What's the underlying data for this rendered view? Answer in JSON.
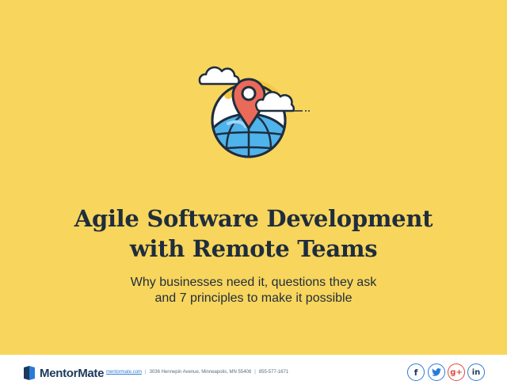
{
  "document": {
    "title_line1": "Agile Software Development",
    "title_line2": "with Remote Teams",
    "subtitle_line1": "Why businesses need it, questions they ask",
    "subtitle_line2": "and 7 principles to make it possible"
  },
  "footer": {
    "brand": "MentorMate",
    "website": "mentormate.com",
    "address": "3036 Hennepin Avenue, Minneapolis, MN 55408",
    "phone": "855-577-1671",
    "separator": "|",
    "social": [
      {
        "name": "facebook-icon",
        "glyph": "f"
      },
      {
        "name": "twitter-icon",
        "glyph": "t"
      },
      {
        "name": "google-plus-icon",
        "glyph": "g+"
      },
      {
        "name": "linkedin-icon",
        "glyph": "in"
      }
    ]
  },
  "colors": {
    "background": "#f8d55c",
    "text": "#1f2d3d",
    "brand": "#1b3a5c",
    "link": "#2a7bd6",
    "google": "#e2493c",
    "pin": "#ea6a5a",
    "globe": "#4fb3ec"
  },
  "illustration": "globe-with-location-pin-and-clouds"
}
